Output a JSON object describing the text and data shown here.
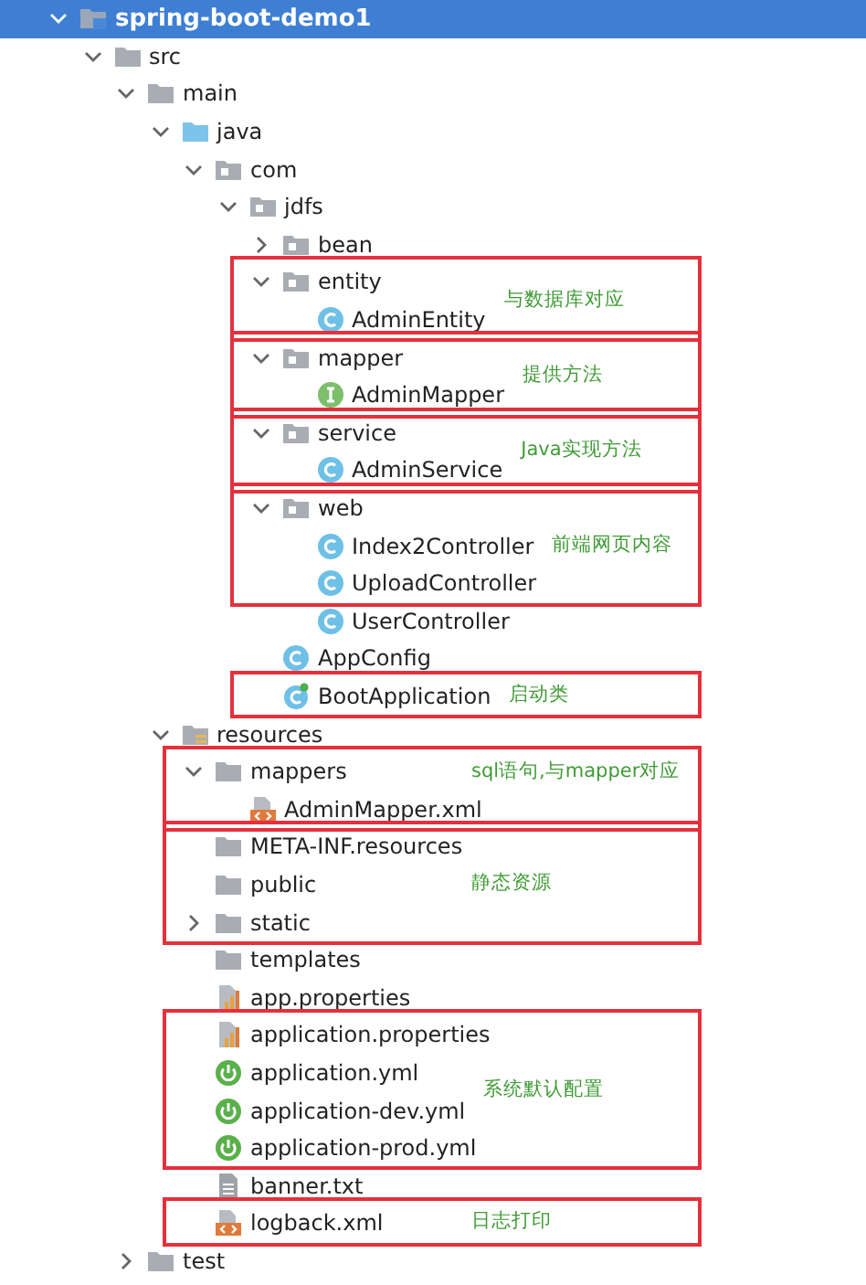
{
  "tree": {
    "label": "spring-boot-demo1",
    "kind": "module",
    "expanded": true,
    "selected": true,
    "children": [
      {
        "label": "src",
        "kind": "folder",
        "expanded": true,
        "selected": false,
        "children": [
          {
            "label": "main",
            "kind": "folder",
            "expanded": true,
            "selected": false,
            "children": [
              {
                "label": "java",
                "kind": "source-folder",
                "expanded": true,
                "selected": false,
                "children": [
                  {
                    "label": "com",
                    "kind": "package",
                    "expanded": true,
                    "selected": false,
                    "children": [
                      {
                        "label": "jdfs",
                        "kind": "package",
                        "expanded": true,
                        "selected": false,
                        "children": [
                          {
                            "label": "bean",
                            "kind": "package",
                            "expanded": false,
                            "selected": false
                          },
                          {
                            "label": "entity",
                            "kind": "package",
                            "expanded": true,
                            "selected": false,
                            "note": "与数据库对应",
                            "children": [
                              {
                                "label": "AdminEntity",
                                "kind": "class",
                                "selected": false,
                                "note_continues": true
                              }
                            ]
                          },
                          {
                            "label": "mapper",
                            "kind": "package",
                            "expanded": true,
                            "selected": false,
                            "note": "提供方法",
                            "children": [
                              {
                                "label": "AdminMapper",
                                "kind": "interface",
                                "selected": false,
                                "note_continues": true
                              }
                            ]
                          },
                          {
                            "label": "service",
                            "kind": "package",
                            "expanded": true,
                            "selected": false,
                            "note": "Java实现方法",
                            "children": [
                              {
                                "label": "AdminService",
                                "kind": "class",
                                "selected": false,
                                "note_continues": true
                              }
                            ]
                          },
                          {
                            "label": "web",
                            "kind": "package",
                            "expanded": true,
                            "selected": false,
                            "note": "前端网页内容",
                            "children": [
                              {
                                "label": "Index2Controller",
                                "kind": "class",
                                "selected": false,
                                "note_continues": true
                              },
                              {
                                "label": "UploadController",
                                "kind": "class",
                                "selected": false,
                                "note_continues": true
                              },
                              {
                                "label": "UserController",
                                "kind": "class",
                                "selected": false
                              }
                            ]
                          },
                          {
                            "label": "AppConfig",
                            "kind": "class",
                            "selected": false
                          },
                          {
                            "label": "BootApplication",
                            "kind": "boot-class",
                            "selected": false,
                            "note": "启动类"
                          }
                        ]
                      }
                    ]
                  }
                ]
              },
              {
                "label": "resources",
                "kind": "resources-folder",
                "expanded": true,
                "selected": false,
                "children": [
                  {
                    "label": "mappers",
                    "kind": "folder",
                    "expanded": true,
                    "selected": false,
                    "note": "sql语句,与mapper对应",
                    "children": [
                      {
                        "label": "AdminMapper.xml",
                        "kind": "xml",
                        "selected": false,
                        "note_continues": true
                      }
                    ]
                  },
                  {
                    "label": "META-INF.resources",
                    "kind": "folder",
                    "selected": false,
                    "note": "静态资源"
                  },
                  {
                    "label": "public",
                    "kind": "folder",
                    "selected": false,
                    "note_continues": true
                  },
                  {
                    "label": "static",
                    "kind": "folder",
                    "expanded": false,
                    "selected": false,
                    "note_continues": true
                  },
                  {
                    "label": "templates",
                    "kind": "folder",
                    "selected": false
                  },
                  {
                    "label": "app.properties",
                    "kind": "properties",
                    "selected": false
                  },
                  {
                    "label": "application.properties",
                    "kind": "properties",
                    "selected": false,
                    "note": "系统默认配置"
                  },
                  {
                    "label": "application.yml",
                    "kind": "spring-config",
                    "selected": false,
                    "note_continues": true
                  },
                  {
                    "label": "application-dev.yml",
                    "kind": "spring-config",
                    "selected": false,
                    "note_continues": true
                  },
                  {
                    "label": "application-prod.yml",
                    "kind": "spring-config",
                    "selected": false,
                    "note_continues": true
                  },
                  {
                    "label": "banner.txt",
                    "kind": "text-file",
                    "selected": false
                  },
                  {
                    "label": "logback.xml",
                    "kind": "xml",
                    "selected": false,
                    "note": "日志打印"
                  }
                ]
              }
            ]
          },
          {
            "label": "test",
            "kind": "folder",
            "expanded": false,
            "selected": false
          }
        ]
      }
    ]
  }
}
